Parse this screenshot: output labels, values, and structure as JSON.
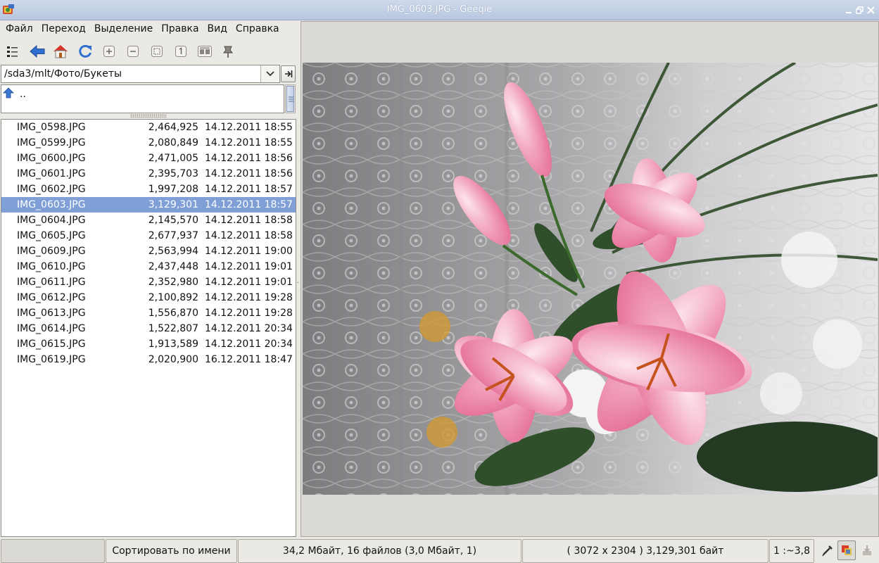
{
  "window": {
    "title": "IMG_0603.JPG - Geeqie",
    "app_icon": "geeqie-icon",
    "controls": [
      "minimize-icon",
      "maximize-icon",
      "close-icon"
    ]
  },
  "menubar": {
    "items": [
      "Файл",
      "Переход",
      "Выделение",
      "Правка",
      "Вид",
      "Справка"
    ]
  },
  "toolbar": {
    "icons": [
      "thumbnails-icon",
      "back-arrow-icon",
      "home-icon",
      "refresh-icon",
      "zoom-in-icon",
      "zoom-out-icon",
      "zoom-fit-icon",
      "zoom-1-1-icon",
      "float-icon",
      "pin-icon"
    ]
  },
  "path": {
    "value": "/sda3/mlt/Фото/Букеты"
  },
  "dirlist": {
    "items": [
      {
        "icon": "up-arrow-icon",
        "label": ".."
      }
    ]
  },
  "files": [
    {
      "name": "IMG_0598.JPG",
      "size": "2,464,925",
      "date": "14.12.2011 18:55",
      "selected": false
    },
    {
      "name": "IMG_0599.JPG",
      "size": "2,080,849",
      "date": "14.12.2011 18:55",
      "selected": false
    },
    {
      "name": "IMG_0600.JPG",
      "size": "2,471,005",
      "date": "14.12.2011 18:56",
      "selected": false
    },
    {
      "name": "IMG_0601.JPG",
      "size": "2,395,703",
      "date": "14.12.2011 18:56",
      "selected": false
    },
    {
      "name": "IMG_0602.JPG",
      "size": "1,997,208",
      "date": "14.12.2011 18:57",
      "selected": false
    },
    {
      "name": "IMG_0603.JPG",
      "size": "3,129,301",
      "date": "14.12.2011 18:57",
      "selected": true
    },
    {
      "name": "IMG_0604.JPG",
      "size": "2,145,570",
      "date": "14.12.2011 18:58",
      "selected": false
    },
    {
      "name": "IMG_0605.JPG",
      "size": "2,677,937",
      "date": "14.12.2011 18:58",
      "selected": false
    },
    {
      "name": "IMG_0609.JPG",
      "size": "2,563,994",
      "date": "14.12.2011 19:00",
      "selected": false
    },
    {
      "name": "IMG_0610.JPG",
      "size": "2,437,448",
      "date": "14.12.2011 19:01",
      "selected": false
    },
    {
      "name": "IMG_0611.JPG",
      "size": "2,352,980",
      "date": "14.12.2011 19:01",
      "selected": false
    },
    {
      "name": "IMG_0612.JPG",
      "size": "2,100,892",
      "date": "14.12.2011 19:28",
      "selected": false
    },
    {
      "name": "IMG_0613.JPG",
      "size": "1,556,870",
      "date": "14.12.2011 19:28",
      "selected": false
    },
    {
      "name": "IMG_0614.JPG",
      "size": "1,522,807",
      "date": "14.12.2011 20:34",
      "selected": false
    },
    {
      "name": "IMG_0615.JPG",
      "size": "1,913,589",
      "date": "14.12.2011 20:34",
      "selected": false
    },
    {
      "name": "IMG_0619.JPG",
      "size": "2,020,900",
      "date": "16.12.2011 18:47",
      "selected": false
    }
  ],
  "colors": {
    "selection": "#7f9fd6",
    "titlebar": "#b8c7df"
  },
  "statusbar": {
    "sort": "Сортировать по имени",
    "stats": "34,2 Мбайт, 16 файлов (3,0 Мбайт, 1)",
    "dimensions": "( 3072 x 2304 ) 3,129,301 байт",
    "zoom": "1 :~3,8",
    "icons": [
      "color-picker-icon",
      "color-profile-icon",
      "write-metadata-icon"
    ]
  }
}
